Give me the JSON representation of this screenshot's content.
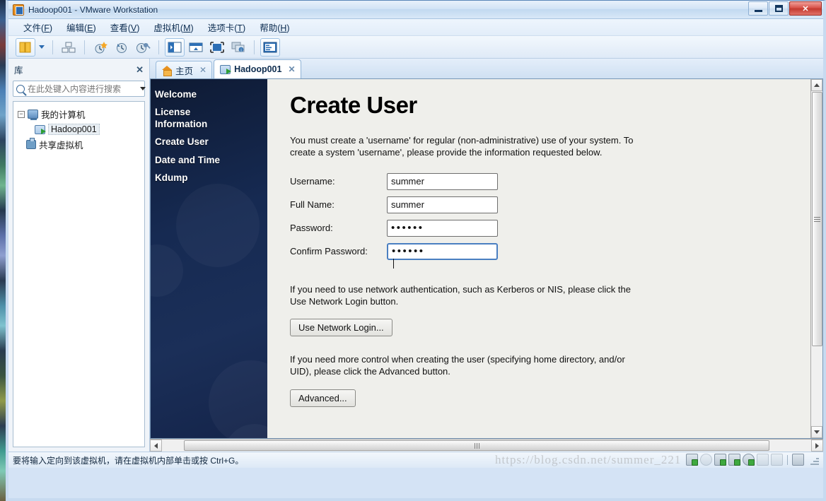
{
  "window": {
    "title": "Hadoop001 - VMware Workstation",
    "icon": "vmware-icon",
    "controls": {
      "minimize": "minimize-button",
      "maximize": "restore-button",
      "close": "close-button"
    }
  },
  "menubar": [
    {
      "label": "文件",
      "accel": "F"
    },
    {
      "label": "编辑",
      "accel": "E"
    },
    {
      "label": "查看",
      "accel": "V"
    },
    {
      "label": "虚拟机",
      "accel": "M"
    },
    {
      "label": "选项卡",
      "accel": "T"
    },
    {
      "label": "帮助",
      "accel": "H"
    }
  ],
  "toolbar": {
    "buttons": [
      {
        "name": "show-hide-library-icon",
        "active": true
      },
      {
        "name": "toolbar-dropdown-caret",
        "active": false
      },
      {
        "name": "manage-snapshots-icon",
        "active": false
      },
      {
        "name": "take-snapshot-icon",
        "active": false
      },
      {
        "name": "revert-snapshot-icon",
        "active": false
      },
      {
        "name": "snapshot-manager-icon",
        "active": false
      },
      {
        "name": "show-console-view-icon",
        "active": false
      },
      {
        "name": "show-thumbnail-bar-icon",
        "active": false
      },
      {
        "name": "enter-fullscreen-icon",
        "active": false
      },
      {
        "name": "unity-mode-icon",
        "active": false
      },
      {
        "name": "show-library-pane-icon",
        "active": false
      }
    ]
  },
  "library": {
    "title": "库",
    "close_label": "✕",
    "search_placeholder": "在此处键入内容进行搜索",
    "search_value": "",
    "tree": [
      {
        "label": "我的计算机",
        "icon": "computer-icon",
        "expanded": true,
        "expander": "−",
        "selected": false
      },
      {
        "label": "Hadoop001",
        "icon": "virtual-machine-icon",
        "indent": true,
        "selected": true
      },
      {
        "label": "共享虚拟机",
        "icon": "shared-vms-icon",
        "selected": false
      }
    ]
  },
  "tabs": [
    {
      "label": "主页",
      "icon": "home-icon",
      "active": false,
      "close": "✕"
    },
    {
      "label": "Hadoop001",
      "icon": "virtual-machine-icon",
      "active": true,
      "close": "✕"
    }
  ],
  "installer": {
    "nav_steps": [
      {
        "label": "Welcome",
        "current": false
      },
      {
        "label": "License Information",
        "current": false
      },
      {
        "label": "Create User",
        "current": true
      },
      {
        "label": "Date and Time",
        "current": false
      },
      {
        "label": "Kdump",
        "current": false
      }
    ],
    "title": "Create User",
    "intro": "You must create a 'username' for regular (non-administrative) use of your system.  To create a system 'username', please provide the information requested below.",
    "form": [
      {
        "label": "Username:",
        "value": "summer",
        "type": "text",
        "focused": false
      },
      {
        "label": "Full Name:",
        "value": "summer",
        "type": "text",
        "focused": false
      },
      {
        "label": "Password:",
        "value": "••••••",
        "type": "password",
        "focused": false
      },
      {
        "label": "Confirm Password:",
        "value": "••••••",
        "type": "password",
        "focused": true
      }
    ],
    "network_para": "If you need to use network authentication, such as Kerberos or NIS, please click the Use Network Login button.",
    "network_button": "Use Network Login...",
    "advanced_para": "If you need more control when creating the user (specifying home directory, and/or UID), please click the Advanced button.",
    "advanced_button": "Advanced..."
  },
  "statusbar": {
    "message": "要将输入定向到该虚拟机，请在虚拟机内部单击或按 Ctrl+G。",
    "watermark": "https://blog.csdn.net/summer_221",
    "device_icons": [
      "hard-disk-icon",
      "cd-dvd-icon",
      "network-adapter-icon",
      "printer-icon",
      "usb-controller-icon",
      "keyboard-icon",
      "camera-icon"
    ]
  },
  "colors": {
    "accent": "#2a6ab0",
    "installer_sidebar": "#162a52",
    "installer_body": "#efefeb",
    "focus_border": "#4a7fc1",
    "close_button": "#c33a30"
  }
}
